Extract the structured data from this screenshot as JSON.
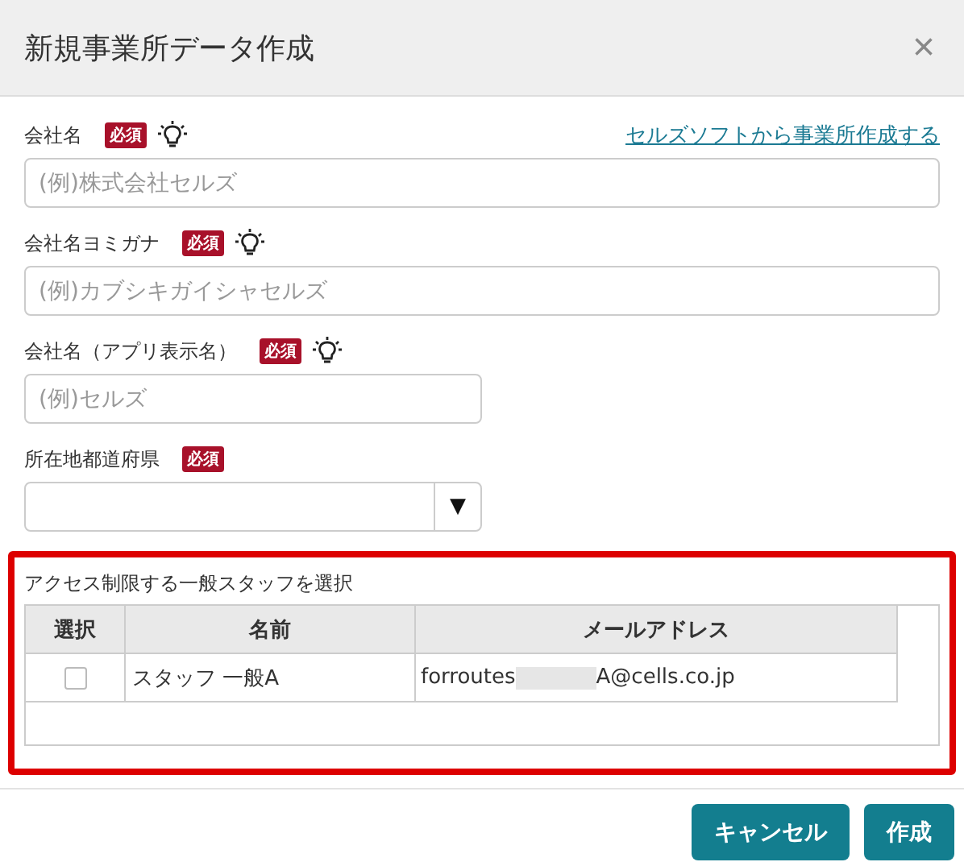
{
  "dialog": {
    "title": "新規事業所データ作成",
    "close": "×"
  },
  "link": "セルズソフトから事業所作成する",
  "fields": [
    {
      "label": "会社名",
      "required_badge": "必須",
      "hint": true,
      "kind": "text",
      "placeholder": "(例)株式会社セルズ",
      "wide": true
    },
    {
      "label": "会社名ヨミガナ",
      "required_badge": "必須",
      "hint": true,
      "kind": "text",
      "placeholder": "(例)カブシキガイシャセルズ",
      "wide": true
    },
    {
      "label": "会社名（アプリ表示名）",
      "required_badge": "必須",
      "hint": true,
      "kind": "text",
      "placeholder": "(例)セルズ",
      "wide": false
    },
    {
      "label": "所在地都道府県",
      "required_badge": "必須",
      "hint": false,
      "kind": "select",
      "arrow": "▼",
      "wide": false
    }
  ],
  "staff_section": {
    "title": "アクセス制限する一般スタッフを選択",
    "highlighted": true,
    "columns": [
      "選択",
      "名前",
      "メールアドレス"
    ],
    "rows": [
      {
        "checked": false,
        "name": "スタッフ 一般A",
        "email_start": "forroutes",
        "email_end": "A@cells.co.jp"
      }
    ]
  },
  "buttons": [
    "キャンセル",
    "作成"
  ]
}
